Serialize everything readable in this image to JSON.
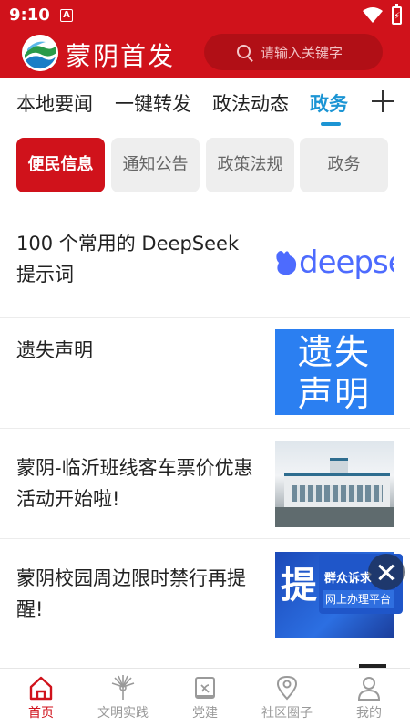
{
  "status_bar": {
    "time": "9:10",
    "notification_letter": "A"
  },
  "header": {
    "app_title": "蒙阴首发",
    "search_placeholder": "请输入关键字",
    "brand_color": "#d0121b"
  },
  "channels": {
    "tabs": [
      {
        "label": "本地要闻",
        "active": false
      },
      {
        "label": "一键转发",
        "active": false
      },
      {
        "label": "政法动态",
        "active": false
      },
      {
        "label": "政务",
        "active": true
      }
    ],
    "add_icon": "plus-icon",
    "active_color": "#1c95d4"
  },
  "subtabs": [
    {
      "label": "便民信息",
      "active": true
    },
    {
      "label": "通知公告",
      "active": false
    },
    {
      "label": "政策法规",
      "active": false
    },
    {
      "label": "政务",
      "active": false
    }
  ],
  "news": [
    {
      "title": "100 个常用的 DeepSeek 提示词",
      "thumb_text": "deepse"
    },
    {
      "title": "遗失声明",
      "thumb_text_1": "遗失",
      "thumb_text_2": "声明"
    },
    {
      "title": "蒙阴-临沂班线客车票价优惠活动开始啦!"
    },
    {
      "title": "蒙阴校园周边限时禁行再提醒!",
      "thumb_text": "提"
    }
  ],
  "floating_ad": {
    "line1": "群众诉求",
    "line2": "网上办理平台"
  },
  "bottom_nav": [
    {
      "label": "首页",
      "icon": "home-icon",
      "active": true
    },
    {
      "label": "文明实践",
      "icon": "peacock-icon",
      "active": false
    },
    {
      "label": "党建",
      "icon": "party-book-icon",
      "active": false
    },
    {
      "label": "社区圈子",
      "icon": "location-pin-icon",
      "active": false
    },
    {
      "label": "我的",
      "icon": "user-icon",
      "active": false
    }
  ]
}
